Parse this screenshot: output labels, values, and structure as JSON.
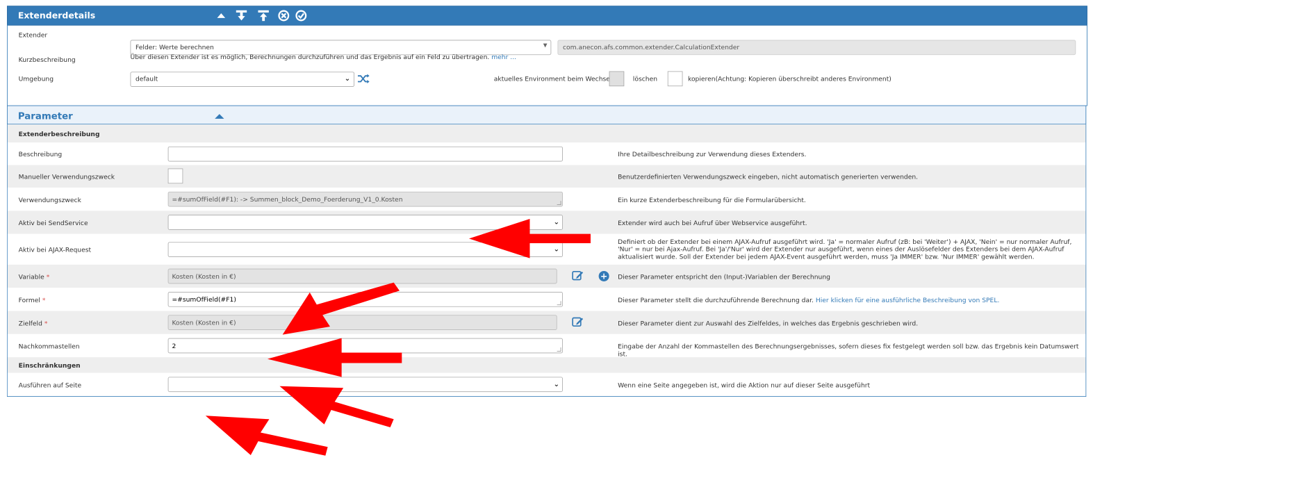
{
  "panel": {
    "title": "Extenderdetails",
    "icons": [
      "collapse-up-icon",
      "download-icon",
      "upload-icon",
      "cancel-icon",
      "confirm-icon"
    ]
  },
  "extender": {
    "label": "Extender",
    "select_value": "Felder: Werte berechnen",
    "class_name": "com.anecon.afs.common.extender.CalculationExtender"
  },
  "kurz": {
    "label": "Kurzbeschreibung",
    "text": "Über diesen Extender ist es möglich, Berechnungen durchzuführen und das Ergebnis auf ein Feld zu übertragen.",
    "more": "mehr ..."
  },
  "umgebung": {
    "label": "Umgebung",
    "select_value": "default",
    "shuffle_icon": "shuffle-icon",
    "env_label": "aktuelles Environment beim Wechseln",
    "delete_label": "löschen",
    "copy_label": "kopieren(Achtung: Kopieren überschreibt anderes Environment)"
  },
  "params": {
    "title": "Parameter",
    "section1": "Extenderbeschreibung",
    "section2": "Einschränkungen",
    "rows": {
      "beschreibung": {
        "label": "Beschreibung",
        "value": "",
        "desc": "Ihre Detailbeschreibung zur Verwendung dieses Extenders."
      },
      "manuell": {
        "label": "Manueller Verwendungszweck",
        "desc": "Benutzerdefinierten Verwendungszweck eingeben, nicht automatisch generierten verwenden."
      },
      "zweck": {
        "label": "Verwendungszweck",
        "value": "=#sumOfField(#F1):  -> Summen_block_Demo_Foerderung_V1_0.Kosten",
        "desc": "Ein kurze Extenderbeschreibung für die Formularübersicht."
      },
      "sendservice": {
        "label": "Aktiv bei SendService",
        "value": "",
        "desc": "Extender wird auch bei Aufruf über Webservice ausgeführt."
      },
      "ajax": {
        "label": "Aktiv bei AJAX-Request",
        "value": "",
        "desc": "Definiert ob der Extender bei einem AJAX-Aufruf ausgeführt wird. 'Ja' = normaler Aufruf (zB: bei 'Weiter') + AJAX, 'Nein' = nur normaler Aufruf, 'Nur' = nur bei Ajax-Aufruf. Bei 'Ja'/'Nur' wird der Extender nur ausgeführt, wenn eines der Auslösefelder des Extenders bei dem AJAX-Aufruf aktualisiert wurde. Soll der Extender bei jedem AJAX-Event ausgeführt werden, muss 'Ja IMMER' bzw. 'Nur IMMER' gewählt werden."
      },
      "variable": {
        "label": "Variable",
        "value": "Kosten (Kosten in €)",
        "desc": "Dieser Parameter entspricht den (Input-)Variablen der Berechnung"
      },
      "formel": {
        "label": "Formel",
        "value": "=#sumOfField(#F1)",
        "desc": "Dieser Parameter stellt die durchzuführende Berechnung dar.",
        "link": "Hier klicken für eine ausführliche Beschreibung von SPEL."
      },
      "zielfeld": {
        "label": "Zielfeld",
        "value": "Kosten (Kosten in €)",
        "desc": "Dieser Parameter dient zur Auswahl des Zielfeldes, in welches das Ergebnis geschrieben wird."
      },
      "nachkomma": {
        "label": "Nachkommastellen",
        "value": "2",
        "desc": "Eingabe der Anzahl der Kommastellen des Berechnungsergebnisses, sofern dieses fix festgelegt werden soll bzw. das Ergebnis kein Datumswert ist."
      },
      "seite": {
        "label": "Ausführen auf Seite",
        "value": "",
        "desc": "Wenn eine Seite angegeben ist, wird die Aktion nur auf dieser Seite ausgeführt"
      }
    },
    "required_marker": "*"
  },
  "colors": {
    "primary": "#337ab7",
    "arrow": "#ff0000",
    "required": "#d9534f"
  }
}
